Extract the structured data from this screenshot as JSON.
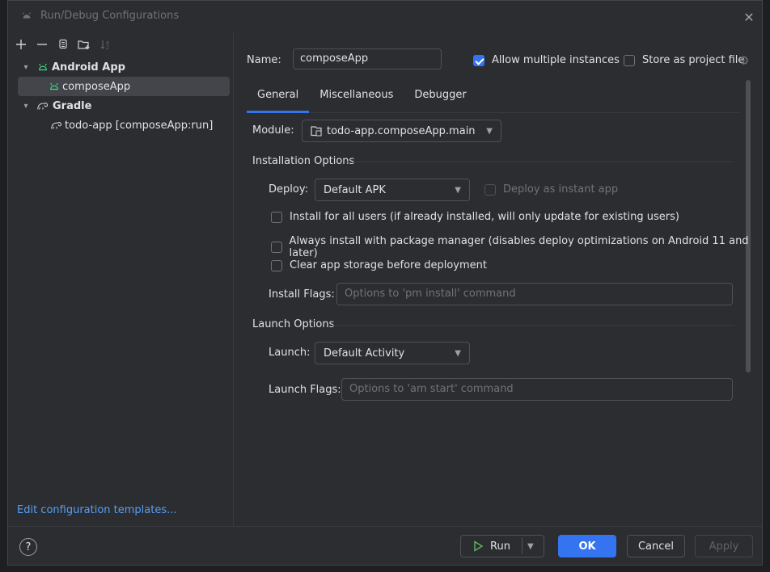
{
  "window": {
    "title": "Run/Debug Configurations"
  },
  "toolbar": {
    "icons": [
      "add-icon",
      "remove-icon",
      "copy-icon",
      "new-folder-icon",
      "sort-icon"
    ]
  },
  "tree": {
    "items": [
      {
        "label": "Android App",
        "icon": "android-icon",
        "level": 0,
        "expanded": true
      },
      {
        "label": "composeApp",
        "icon": "android-icon",
        "level": 1,
        "selected": true
      },
      {
        "label": "Gradle",
        "icon": "gradle-icon",
        "level": 0,
        "expanded": true
      },
      {
        "label": "todo-app [composeApp:run]",
        "icon": "gradle-icon",
        "level": 1
      }
    ]
  },
  "edit_templates_link": "Edit configuration templates...",
  "form": {
    "name_label": "Name:",
    "name_value": "composeApp",
    "allow_multiple_label": "Allow multiple instances",
    "allow_multiple_checked": true,
    "store_as_project_label": "Store as project file",
    "store_as_project_checked": false
  },
  "tabs": [
    {
      "label": "General",
      "active": true
    },
    {
      "label": "Miscellaneous",
      "active": false
    },
    {
      "label": "Debugger",
      "active": false
    }
  ],
  "general": {
    "module_label": "Module:",
    "module_value": "todo-app.composeApp.main",
    "installation_title": "Installation Options",
    "deploy_label": "Deploy:",
    "deploy_value": "Default APK",
    "instant_app_label": "Deploy as instant app",
    "options": [
      "Install for all users (if already installed, will only update for existing users)",
      "Always install with package manager (disables deploy optimizations on Android 11 and later)",
      "Clear app storage before deployment"
    ],
    "install_flags_label": "Install Flags:",
    "install_flags_placeholder": "Options to 'pm install' command",
    "launch_title": "Launch Options",
    "launch_label": "Launch:",
    "launch_value": "Default Activity",
    "launch_flags_label": "Launch Flags:",
    "launch_flags_placeholder": "Options to 'am start' command"
  },
  "footer": {
    "help": "?",
    "run": "Run",
    "ok": "OK",
    "cancel": "Cancel",
    "apply": "Apply"
  },
  "colors": {
    "accent": "#3574f0",
    "android_green": "#3ddc84",
    "link": "#589df6"
  }
}
